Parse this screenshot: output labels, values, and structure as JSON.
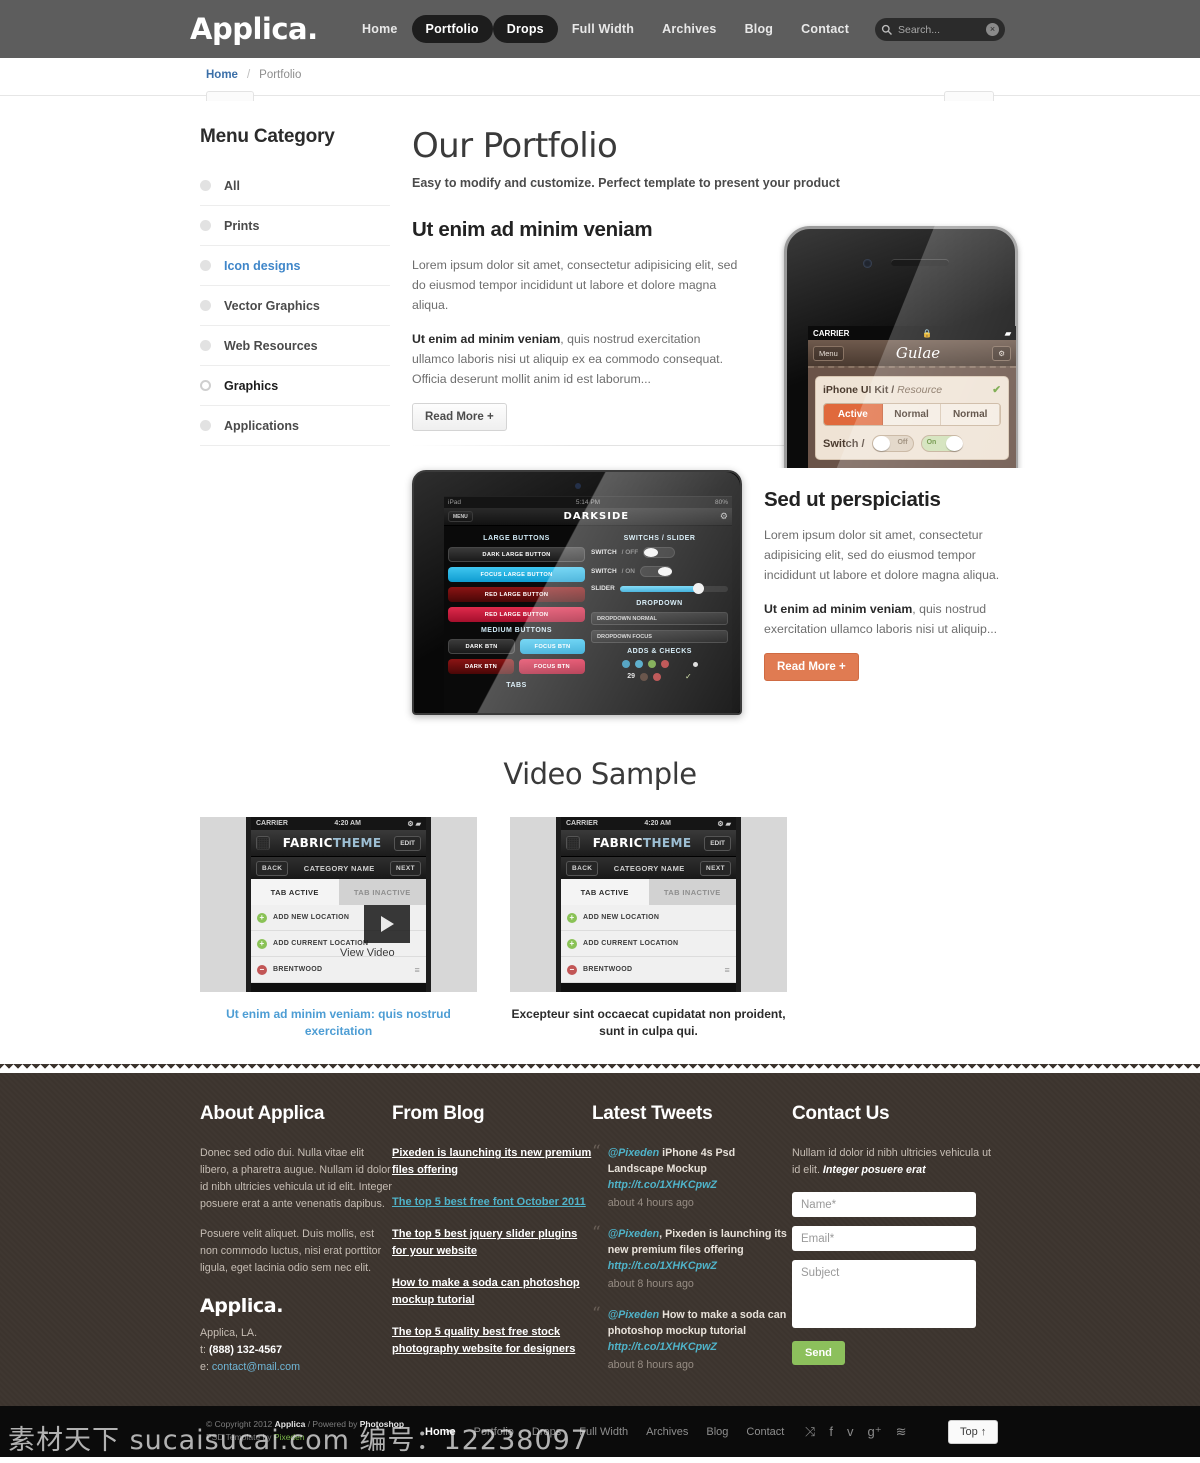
{
  "header": {
    "brand": "Applica.",
    "nav": [
      {
        "label": "Home",
        "active": false
      },
      {
        "label": "Portfolio",
        "active": true
      },
      {
        "label": "Drops",
        "active": true
      },
      {
        "label": "Full Width",
        "active": false
      },
      {
        "label": "Archives",
        "active": false
      },
      {
        "label": "Blog",
        "active": false
      },
      {
        "label": "Contact",
        "active": false
      }
    ],
    "search": {
      "placeholder": "Search...",
      "value": "",
      "clear_label": "×"
    }
  },
  "breadcrumb": {
    "home": "Home",
    "separator": "/",
    "current": "Portfolio"
  },
  "sidebar": {
    "title": "Menu Category",
    "items": [
      {
        "label": "All",
        "state": "normal"
      },
      {
        "label": "Prints",
        "state": "normal"
      },
      {
        "label": "Icon designs",
        "state": "link"
      },
      {
        "label": "Vector Graphics",
        "state": "normal"
      },
      {
        "label": "Web Resources",
        "state": "normal"
      },
      {
        "label": "Graphics",
        "state": "selected"
      },
      {
        "label": "Applications",
        "state": "normal"
      }
    ]
  },
  "main": {
    "title": "Our Portfolio",
    "subtitle": "Easy to modify and customize. Perfect template to present your product",
    "items": [
      {
        "heading": "Ut enim ad minim veniam",
        "para1": "Lorem ipsum dolor sit amet, consectetur adipisicing elit, sed do eiusmod tempor incididunt ut labore et dolore magna aliqua.",
        "para2_bold": "Ut enim ad minim veniam",
        "para2_rest": ", quis nostrud exercitation ullamco laboris nisi ut aliquip ex ea commodo consequat. Officia deserunt mollit anim id est laborum...",
        "button": "Read More +"
      },
      {
        "heading": "Sed ut perspiciatis",
        "para1": "Lorem ipsum dolor sit amet, consectetur adipisicing elit, sed do eiusmod tempor incididunt ut labore et dolore magna aliqua.",
        "para2_bold": "Ut enim ad minim veniam",
        "para2_rest": ", quis nostrud exercitation ullamco laboris nisi ut aliquip...",
        "button": "Read More +"
      }
    ]
  },
  "iphone_mock": {
    "carrier": "CARRIER",
    "lock": "🔒",
    "menu": "Menu",
    "app_name": "Gulae",
    "gear": "⚙",
    "kit_title": "iPhone UI Kit /",
    "kit_sub": "Resource",
    "seg": [
      "Active",
      "Normal",
      "Normal"
    ],
    "switch_label": "Switch /",
    "off": "Off",
    "on": "On"
  },
  "ipad_mock": {
    "status_left": "iPad",
    "status_time": "5:14 PM",
    "status_right": "80%",
    "menu": "MENU",
    "title": "DARKSIDE",
    "col1_head": "LARGE BUTTONS",
    "col1_buttons": [
      "DARK LARGE BUTTON",
      "FOCUS LARGE BUTTON",
      "RED LARGE BUTTON",
      "RED LARGE BUTTON"
    ],
    "col1_head2": "MEDIUM BUTTONS",
    "col1_medium": [
      "DARK BTN",
      "FOCUS BTN",
      "DARK BTN",
      "FOCUS BTN"
    ],
    "col1_head3": "TABS",
    "col2_head": "SWITCHS / SLIDER",
    "switch1": "SWITCH",
    "switch1_state": "/ OFF",
    "switch2": "SWITCH",
    "switch2_state": "/ ON",
    "slider": "SLIDER",
    "col2_head2": "DROPDOWN",
    "dropdowns": [
      "DROPDOWN NORMAL",
      "DROPDOWN FOCUS"
    ],
    "col2_head3": "ADDS & CHECKS",
    "count": "29"
  },
  "video": {
    "title": "Video Sample",
    "play_label": "View Video",
    "thumbs": [
      {
        "carrier": "CARRIER",
        "time": "4:20 AM",
        "brand_a": "FABRIC",
        "brand_b": "THEME",
        "edit": "EDIT",
        "back": "BACK",
        "category": "CATEGORY NAME",
        "next": "NEXT",
        "tab_active": "TAB ACTIVE",
        "tab_inactive": "TAB INACTIVE",
        "rows": [
          "ADD NEW LOCATION",
          "ADD CURRENT LOCATION",
          "BRENTWOOD"
        ],
        "caption": "Ut enim ad minim veniam: quis nostrud exercitation",
        "caption_style": "link",
        "has_play": true
      },
      {
        "carrier": "CARRIER",
        "time": "4:20 AM",
        "brand_a": "FABRIC",
        "brand_b": "THEME",
        "edit": "EDIT",
        "back": "BACK",
        "category": "CATEGORY NAME",
        "next": "NEXT",
        "tab_active": "TAB ACTIVE",
        "tab_inactive": "TAB INACTIVE",
        "rows": [
          "ADD NEW LOCATION",
          "ADD CURRENT LOCATION",
          "BRENTWOOD"
        ],
        "caption": "Excepteur sint occaecat cupidatat non proident, sunt in culpa qui.",
        "caption_style": "plain",
        "has_play": false
      }
    ]
  },
  "footer": {
    "about": {
      "title": "About Applica",
      "p1": "Donec sed odio dui. Nulla vitae elit libero, a pharetra augue. Nullam id dolor id nibh ultricies vehicula ut id elit. Integer posuere erat a ante venenatis dapibus.",
      "p2": "Posuere velit aliquet. Duis mollis, est non commodo luctus, nisi erat porttitor ligula, eget lacinia odio sem nec elit.",
      "logo": "Applica.",
      "address": "Applica, LA.",
      "phone_label": "t:",
      "phone": "(888) 132-4567",
      "email_label": "e:",
      "email": "contact@mail.com"
    },
    "blog": {
      "title": "From Blog",
      "links": [
        {
          "text": "Pixeden is launching its new premium files offering",
          "highlight": false
        },
        {
          "text": "The top 5 best free font October 2011",
          "highlight": true
        },
        {
          "text": "The top 5 best jquery slider plugins for your website",
          "highlight": false
        },
        {
          "text": "How to make a soda can photoshop mockup tutorial",
          "highlight": false
        },
        {
          "text": "The top 5 quality best free stock photography website for designers",
          "highlight": false
        }
      ]
    },
    "tweets": {
      "title": "Latest Tweets",
      "items": [
        {
          "handle": "@Pixeden",
          "text": " iPhone 4s Psd Landscape Mockup ",
          "url": "http://t.co/1XHKCpwZ",
          "ago": "about 4 hours ago"
        },
        {
          "handle": "@Pixeden",
          "text": ", Pixeden is launching its new premium files offering ",
          "url": "http://t.co/1XHKCpwZ",
          "ago": "about 8 hours ago"
        },
        {
          "handle": "@Pixeden",
          "text": " How to make a soda can photoshop mockup tutorial ",
          "url": "http://t.co/1XHKCpwZ",
          "ago": "about 8 hours ago"
        }
      ]
    },
    "contact": {
      "title": "Contact Us",
      "intro_plain": "Nullam id dolor id nibh ultricies vehicula ut id elit. ",
      "intro_em": "Integer posuere erat",
      "name_placeholder": "Name*",
      "email_placeholder": "Email*",
      "subject_placeholder": "Subject",
      "name_value": "",
      "email_value": "",
      "subject_value": "",
      "send": "Send"
    }
  },
  "bottom": {
    "copyright_pre": "© Copyright 2012 ",
    "copyright_brand": "Applica",
    "copyright_mid": " / Powered by ",
    "copyright_tool": "Photoshop",
    "psd_pre": "PSD Template by ",
    "psd_by": "Pixeden",
    "nav": [
      {
        "label": "Home",
        "active": true
      },
      {
        "label": "Portfolio",
        "active": false
      },
      {
        "label": "Drops",
        "active": false
      },
      {
        "label": "Full Width",
        "active": false
      },
      {
        "label": "Archives",
        "active": false
      },
      {
        "label": "Blog",
        "active": false
      },
      {
        "label": "Contact",
        "active": false
      }
    ],
    "socials": [
      {
        "name": "shuffle-icon",
        "glyph": "⤨"
      },
      {
        "name": "facebook-icon",
        "glyph": "f"
      },
      {
        "name": "twitter-icon",
        "glyph": "ᴠ"
      },
      {
        "name": "google-plus-icon",
        "glyph": "g⁺"
      },
      {
        "name": "rss-icon",
        "glyph": "≋"
      }
    ],
    "top_button": "Top ↑"
  },
  "watermark": "素材天下 sucaisucai.com 编号：12238097",
  "colors": {
    "nav_bg": "#5d5d5d",
    "nav_active": "#1d1d1d",
    "accent_blue": "#3f86c9",
    "accent_orange": "#e07b52",
    "footer_bg": "#3c342e",
    "bottom_bg": "#0b0b0b",
    "send_green": "#8cc05c",
    "tweet_teal": "#4fb3c9"
  }
}
